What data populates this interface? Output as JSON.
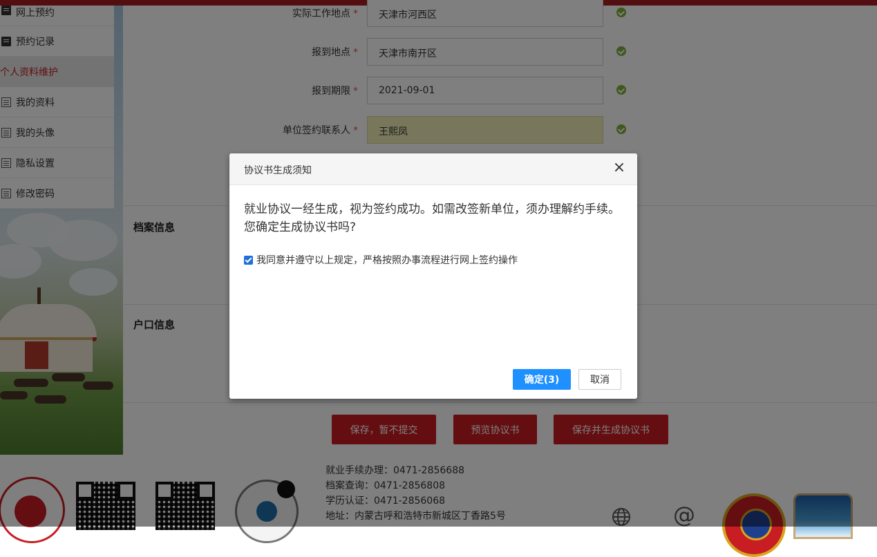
{
  "sidebar": {
    "items": [
      {
        "label": "网上预约",
        "icon": "list-dark-icon"
      },
      {
        "label": "预约记录",
        "icon": "list-dark-icon"
      },
      {
        "label": "个人资料维护"
      },
      {
        "label": "我的资料",
        "icon": "list-outline-icon"
      },
      {
        "label": "我的头像",
        "icon": "list-outline-icon"
      },
      {
        "label": "隐私设置",
        "icon": "list-outline-icon"
      },
      {
        "label": "修改密码",
        "icon": "list-outline-icon"
      }
    ]
  },
  "form": {
    "fields": [
      {
        "label": "实际工作地点",
        "value": "天津市河西区"
      },
      {
        "label": "报到地点",
        "value": "天津市南开区"
      },
      {
        "label": "报到期限",
        "value": "2021-09-01"
      },
      {
        "label": "单位签约联系人",
        "value": "王熙凤"
      }
    ],
    "required_mark": "*",
    "sections": {
      "archive": "档案信息",
      "hukou": "户口信息"
    }
  },
  "actions": {
    "save_draft": "保存，暂不提交",
    "preview": "预览协议书",
    "save_generate": "保存并生成协议书"
  },
  "footer": {
    "lines": [
      "就业手续办理：0471-2856688",
      "档案查询：0471-2856808",
      "学历认证：0471-2856068",
      "地址：内蒙古呼和浩特市新城区丁香路5号"
    ]
  },
  "modal": {
    "title": "协议书生成须知",
    "close": "×",
    "message": "就业协议一经生成，视为签约成功。如需改签新单位，须办理解约手续。您确定生成协议书吗?",
    "agree_text": "我同意并遵守以上规定，严格按照办事流程进行网上签约操作",
    "agree_checked": true,
    "ok_label": "确定(3)",
    "cancel_label": "取消"
  },
  "colors": {
    "brand_red": "#c81d23",
    "primary_blue": "#1e90ff",
    "valid_green": "#7fb03a",
    "highlight_input": "#f0efb8"
  }
}
